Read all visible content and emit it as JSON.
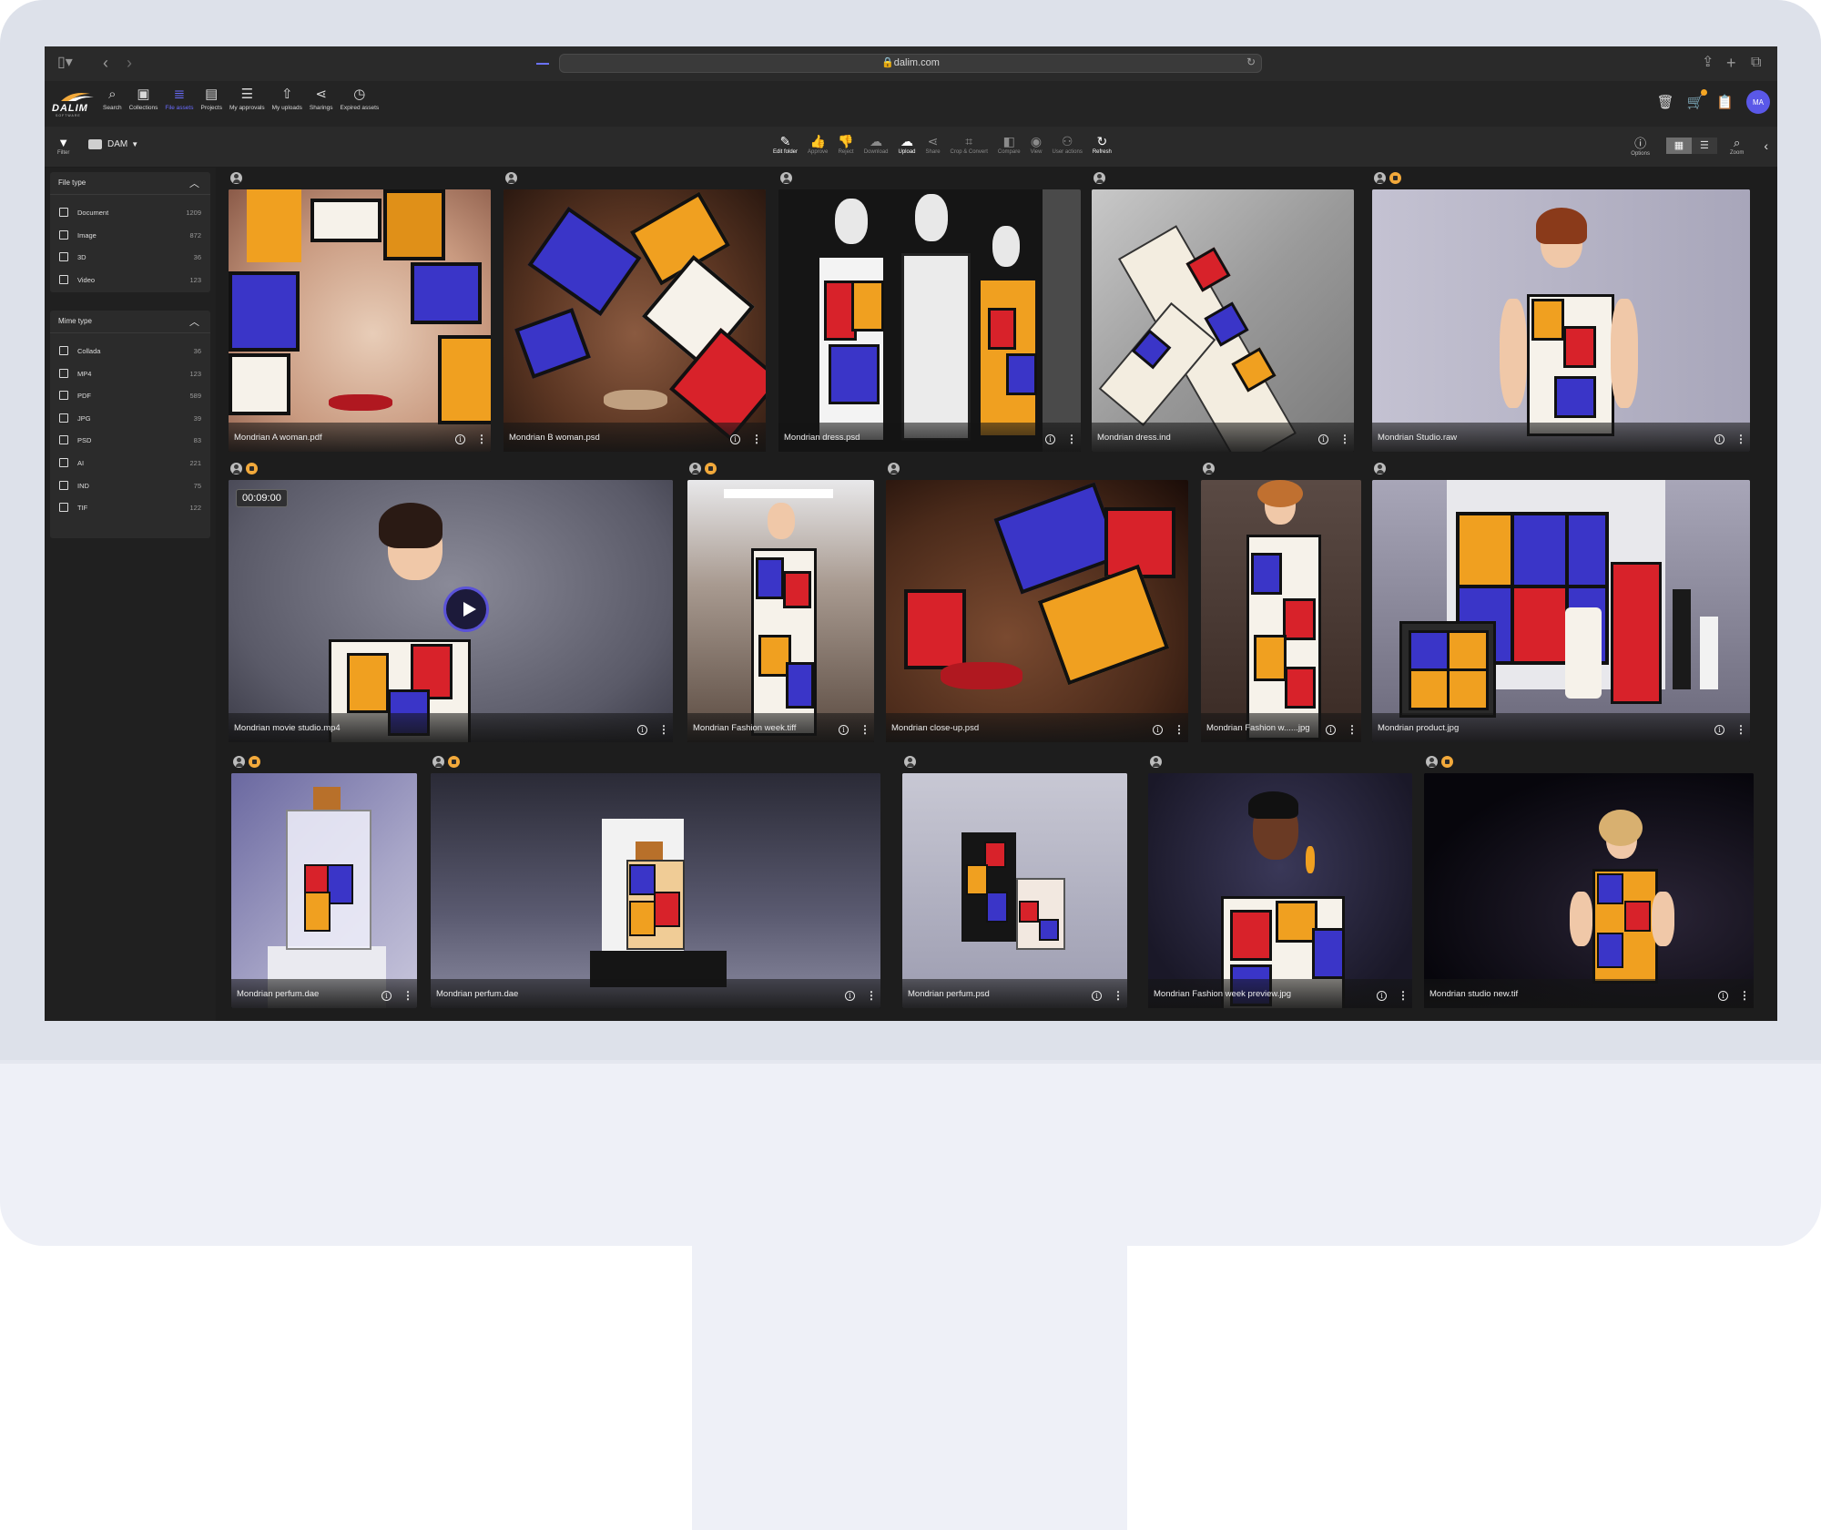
{
  "browser": {
    "url": "dalim.com"
  },
  "nav": {
    "logo": "DALIM",
    "logo_sub": "SOFTWARE",
    "items": [
      {
        "label": "Search",
        "icon": "search-icon"
      },
      {
        "label": "Collections",
        "icon": "collections-icon"
      },
      {
        "label": "File assets",
        "icon": "database-icon"
      },
      {
        "label": "Projects",
        "icon": "briefcase-icon"
      },
      {
        "label": "My approvals",
        "icon": "checklist-icon"
      },
      {
        "label": "My uploads",
        "icon": "upload-icon"
      },
      {
        "label": "Sharings",
        "icon": "share-icon"
      },
      {
        "label": "Expired assets",
        "icon": "clock-icon"
      }
    ],
    "avatar_initials": "MA",
    "active_color": "#6a6cff"
  },
  "toolbar": {
    "filter_label": "Filter",
    "breadcrumb": "DAM",
    "actions": [
      {
        "label": "Edit folder",
        "icon": "pencil-icon",
        "enabled": true
      },
      {
        "label": "Approve",
        "icon": "thumbs-up-icon",
        "enabled": false
      },
      {
        "label": "Reject",
        "icon": "thumbs-down-icon",
        "enabled": false
      },
      {
        "label": "Download",
        "icon": "download-icon",
        "enabled": false
      },
      {
        "label": "Upload",
        "icon": "upload-icon",
        "enabled": true
      },
      {
        "label": "Share",
        "icon": "share-icon",
        "enabled": false
      },
      {
        "label": "Crop & Convert",
        "icon": "crop-icon",
        "enabled": false
      },
      {
        "label": "Compare",
        "icon": "compare-icon",
        "enabled": false
      },
      {
        "label": "View",
        "icon": "eye-icon",
        "enabled": false
      },
      {
        "label": "User actions",
        "icon": "user-actions-icon",
        "enabled": false
      },
      {
        "label": "Refresh",
        "icon": "refresh-icon",
        "enabled": true
      }
    ],
    "options_label": "Options",
    "zoom_label": "Zoom"
  },
  "sidebar": {
    "file_type": {
      "title": "File type",
      "items": [
        {
          "label": "Document",
          "count": "1209"
        },
        {
          "label": "Image",
          "count": "872"
        },
        {
          "label": "3D",
          "count": "36"
        },
        {
          "label": "Video",
          "count": "123"
        }
      ]
    },
    "mime_type": {
      "title": "Mime type",
      "items": [
        {
          "label": "Collada",
          "count": "36"
        },
        {
          "label": "MP4",
          "count": "123"
        },
        {
          "label": "PDF",
          "count": "589"
        },
        {
          "label": "JPG",
          "count": "39"
        },
        {
          "label": "PSD",
          "count": "83"
        },
        {
          "label": "AI",
          "count": "221"
        },
        {
          "label": "IND",
          "count": "75"
        },
        {
          "label": "TIF",
          "count": "122"
        }
      ]
    }
  },
  "assets": [
    {
      "name": "Mondrian A woman.pdf"
    },
    {
      "name": "Mondrian B woman.psd"
    },
    {
      "name": "Mondrian dress.psd"
    },
    {
      "name": "Mondrian dress.ind"
    },
    {
      "name": "Mondrian Studio.raw"
    },
    {
      "name": "Mondrian movie studio.mp4",
      "duration": "00:09:00"
    },
    {
      "name": "Mondrian Fashion week.tiff"
    },
    {
      "name": "Mondrian close-up.psd"
    },
    {
      "name": "Mondrian Fashion w......jpg"
    },
    {
      "name": "Mondrian product.jpg"
    },
    {
      "name": "Mondrian perfum.dae"
    },
    {
      "name": "Mondrian perfum.dae"
    },
    {
      "name": "Mondrian perfum.psd"
    },
    {
      "name": "Mondrian Fashion week preview.jpg"
    },
    {
      "name": "Mondrian studio new.tif"
    }
  ],
  "palette": {
    "red": "#d8222a",
    "blue": "#3a35c8",
    "yellow": "#f0a020",
    "badge_orange": "#f2a93b"
  }
}
